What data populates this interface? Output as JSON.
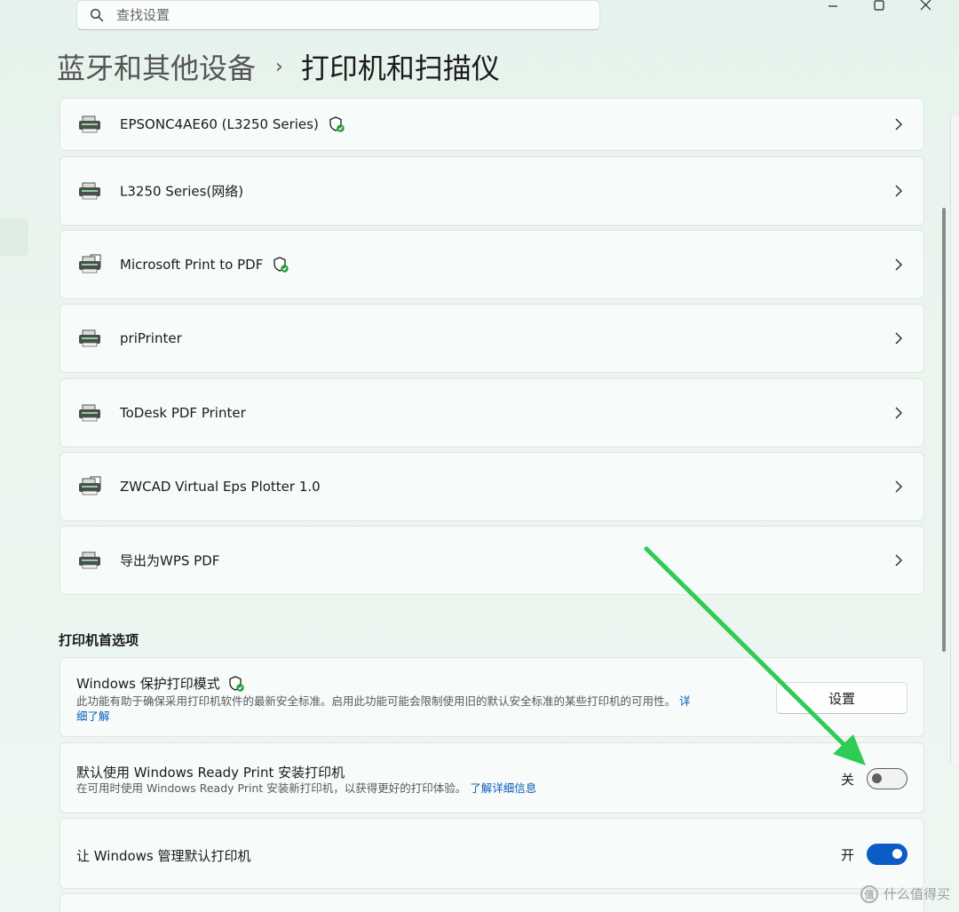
{
  "search": {
    "placeholder": "查找设置",
    "icon": "search-icon"
  },
  "window_controls": [
    "minimize",
    "maximize",
    "close"
  ],
  "breadcrumb": {
    "parent": "蓝牙和其他设备",
    "separator": "›",
    "current": "打印机和扫描仪"
  },
  "printers": [
    {
      "name": "EPSONC4AE60 (L3250 Series)",
      "protected": true
    },
    {
      "name": "L3250 Series(网络)",
      "protected": false
    },
    {
      "name": "Microsoft Print to PDF",
      "protected": true
    },
    {
      "name": "priPrinter",
      "protected": false
    },
    {
      "name": "ToDesk PDF Printer",
      "protected": false
    },
    {
      "name": "ZWCAD Virtual Eps Plotter 1.0",
      "protected": false
    },
    {
      "name": "导出为WPS PDF",
      "protected": false
    }
  ],
  "preferences": {
    "section_title": "打印机首选项",
    "protected_mode": {
      "title": "Windows 保护打印模式",
      "desc": "此功能有助于确保采用打印机软件的最新安全标准。启用此功能可能会限制使用旧的默认安全标准的某些打印机的可用性。",
      "link_part1": "详",
      "link_part2": "细了解",
      "button": "设置"
    },
    "ready_print": {
      "title": "默认使用 Windows Ready Print 安装打印机",
      "desc": "在可用时使用 Windows Ready Print 安装新打印机，以获得更好的打印体验。",
      "link": "了解详细信息",
      "toggle_label": "关",
      "toggle_on": false
    },
    "manage_default": {
      "title": "让 Windows 管理默认打印机",
      "toggle_label": "开",
      "toggle_on": true
    }
  },
  "watermark": {
    "badge": "值",
    "text": "什么值得买"
  },
  "colors": {
    "accent": "#0b5cc4",
    "link": "#0a5db8",
    "shield_green": "#1f9d3a",
    "annotation_arrow": "#2ecc55"
  }
}
